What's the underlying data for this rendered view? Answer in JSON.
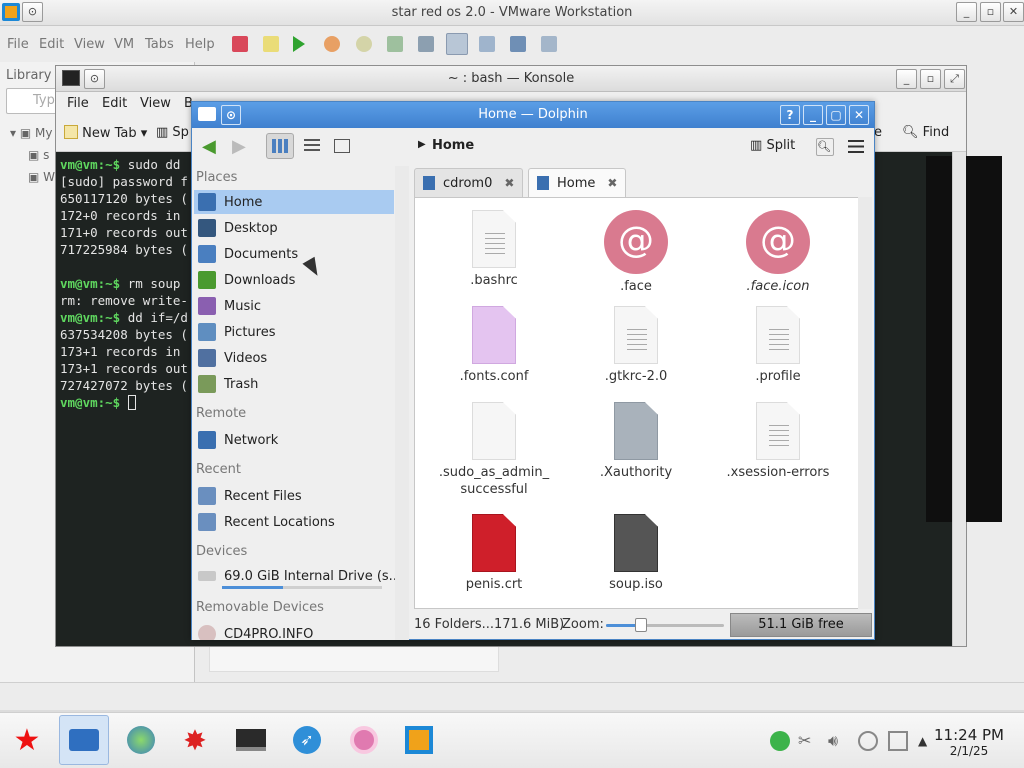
{
  "vmware": {
    "title": "star red os 2.0 - VMware Workstation",
    "menu": [
      "File",
      "Edit",
      "View",
      "VM",
      "Tabs",
      "Help"
    ],
    "library_label": "Library",
    "search_placeholder": "Typ",
    "tree_partial": [
      "My",
      "s",
      "W"
    ]
  },
  "konsole": {
    "title": "~ : bash — Konsole",
    "menu": [
      "File",
      "Edit",
      "View",
      "B"
    ],
    "toolbar": {
      "new_tab": "New Tab",
      "split_partial": "Sp",
      "find": "Find",
      "partial_right": "e"
    },
    "lines": [
      {
        "prompt": "vm@vm:~$",
        "text": " sudo dd"
      },
      {
        "prompt": "",
        "text": "[sudo] password f"
      },
      {
        "prompt": "",
        "text": "650117120 bytes ("
      },
      {
        "prompt": "",
        "text": "172+0 records in"
      },
      {
        "prompt": "",
        "text": "171+0 records out"
      },
      {
        "prompt": "",
        "text": "717225984 bytes ("
      },
      {
        "prompt": "",
        "text": ""
      },
      {
        "prompt": "vm@vm:~$",
        "text": " rm soup"
      },
      {
        "prompt": "",
        "text": "rm: remove write-"
      },
      {
        "prompt": "vm@vm:~$",
        "text": " dd if=/d"
      },
      {
        "prompt": "",
        "text": "637534208 bytes ("
      },
      {
        "prompt": "",
        "text": "173+1 records in"
      },
      {
        "prompt": "",
        "text": "173+1 records out"
      },
      {
        "prompt": "",
        "text": "727427072 bytes ("
      },
      {
        "prompt": "vm@vm:~$",
        "text": " "
      }
    ]
  },
  "dolphin": {
    "title": "Home — Dolphin",
    "breadcrumb": "Home",
    "split_label": "Split",
    "sections": {
      "places": "Places",
      "remote": "Remote",
      "recent": "Recent",
      "devices": "Devices",
      "removable": "Removable Devices"
    },
    "places": [
      "Home",
      "Desktop",
      "Documents",
      "Downloads",
      "Music",
      "Pictures",
      "Videos",
      "Trash"
    ],
    "remote": [
      "Network"
    ],
    "recent": [
      "Recent Files",
      "Recent Locations"
    ],
    "devices": [
      "69.0 GiB Internal Drive (s..."
    ],
    "removable": [
      "CD4PRO.INFO"
    ],
    "tabs": [
      "cdrom0",
      "Home"
    ],
    "files": [
      {
        "name": ".bashrc",
        "icon": "text-file-icon"
      },
      {
        "name": ".face",
        "icon": "debian-logo-icon"
      },
      {
        "name": ".face.icon",
        "icon": "debian-logo-link-icon"
      },
      {
        "name": ".fonts.conf",
        "icon": "xml-file-icon"
      },
      {
        "name": ".gtkrc-2.0",
        "icon": "text-file-icon"
      },
      {
        "name": ".profile",
        "icon": "text-file-icon"
      },
      {
        "name": ".sudo_as_admin_\nsuccessful",
        "icon": "empty-file-icon"
      },
      {
        "name": ".Xauthority",
        "icon": "unknown-file-icon"
      },
      {
        "name": ".xsession-errors",
        "icon": "text-file-icon"
      },
      {
        "name": "penis.crt",
        "icon": "certificate-file-icon"
      },
      {
        "name": "soup.iso",
        "icon": "disk-image-icon"
      }
    ],
    "status": {
      "info": "16 Folders...171.6 MiB)",
      "zoom_label": "Zoom:",
      "zoom_level": 0.3,
      "free": "51.1 GiB free"
    }
  },
  "taskbar": {
    "time": "11:24 PM",
    "date": "2/1/25"
  }
}
